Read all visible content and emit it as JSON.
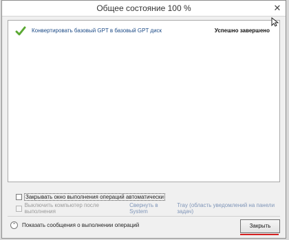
{
  "window": {
    "title": "Общее состояние 100 %",
    "close_glyph": "✕"
  },
  "operations": [
    {
      "description": "Конвертировать базовый GPT в базовый GPT диск",
      "status": "Успешно завершено",
      "icon": "checkmark-icon",
      "icon_color": "#5aa832"
    }
  ],
  "options": {
    "auto_close_label": "Закрывать окно выполнения операций автоматически",
    "auto_close_checked": false,
    "shutdown_label": "Выключить компьютер после выполнения",
    "shutdown_checked": false,
    "shutdown_enabled": false,
    "minimize_link": "Свернуть в System",
    "tray_link": "Tray (область уведомлений на панели задач)"
  },
  "footer": {
    "show_messages_label": "Показать сообщения о выполнении операций",
    "expand_icon": "chevron-up-circle-icon",
    "close_button_label": "Закрыть"
  },
  "colors": {
    "accent_underline": "#d42020",
    "link": "#7f95b8"
  }
}
